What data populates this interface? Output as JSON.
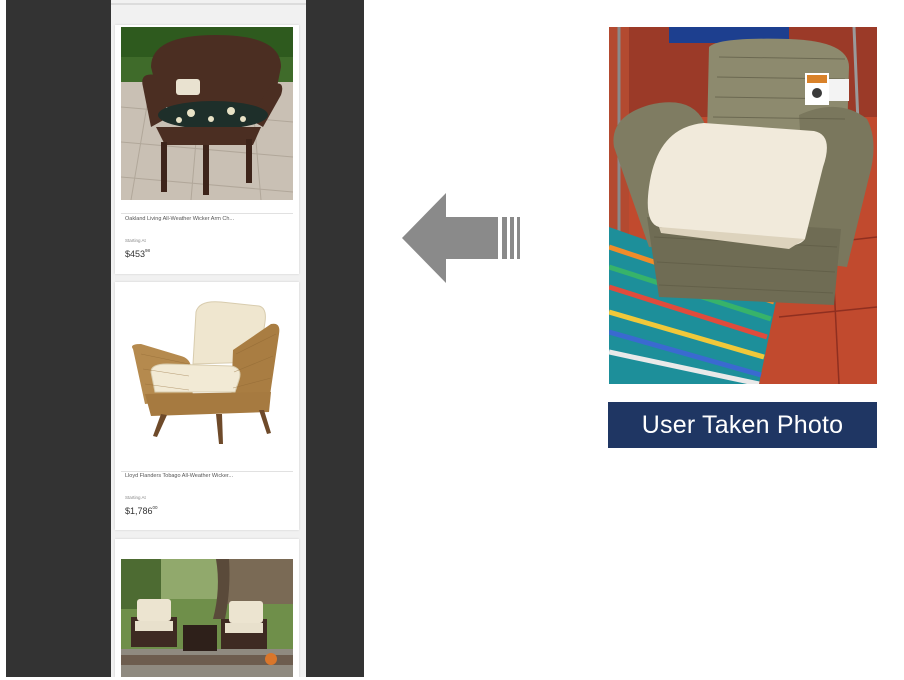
{
  "products": [
    {
      "title": "Oakland Living All-Weather Wicker Arm Ch...",
      "starting_label": "Starting At",
      "price_main": "$453",
      "price_cents": "98"
    },
    {
      "title": "Lloyd Flanders Tobago All-Weather Wicker...",
      "starting_label": "Starting At",
      "price_main": "$1,786",
      "price_cents": "00"
    }
  ],
  "user_photo": {
    "caption": "User Taken Photo"
  },
  "colors": {
    "phone_bg": "#333333",
    "caption_bg": "#1f3663",
    "arrow": "#8a8a8a"
  }
}
